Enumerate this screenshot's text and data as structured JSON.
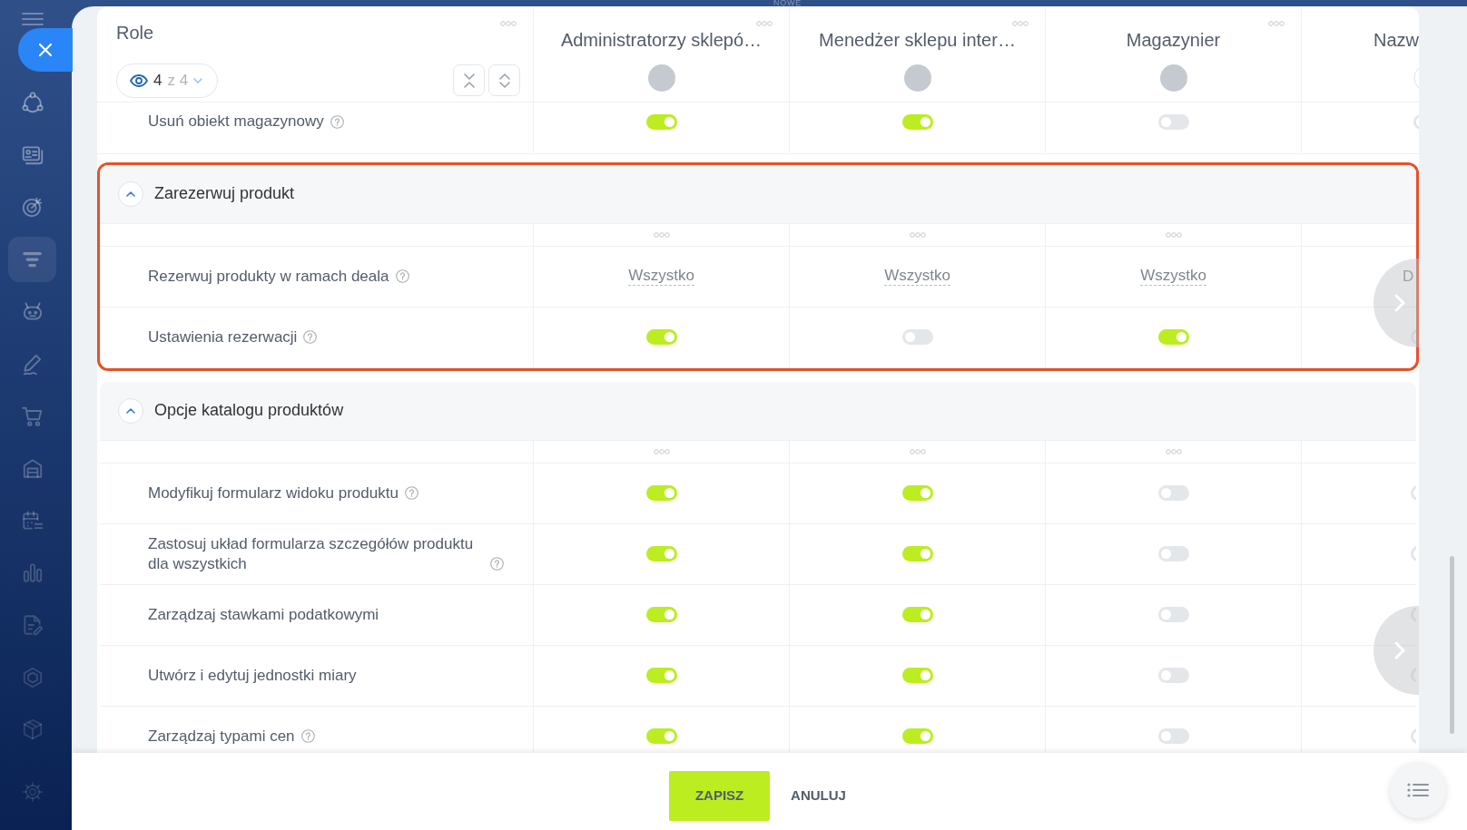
{
  "top_bar": {
    "label": "NOWE"
  },
  "sidebar": {
    "items": [
      {
        "selected": false
      },
      {
        "selected": false
      },
      {
        "selected": false
      },
      {
        "selected": true
      },
      {
        "selected": false
      },
      {
        "selected": false
      },
      {
        "selected": false
      },
      {
        "selected": false
      },
      {
        "selected": false
      },
      {
        "selected": false
      },
      {
        "selected": false
      },
      {
        "selected": false
      },
      {
        "selected": false
      },
      {
        "selected": false
      }
    ]
  },
  "roles_header": {
    "title": "Role",
    "filter": {
      "shown": "4",
      "of": "z 4"
    },
    "roles": [
      {
        "name": "Administratorzy sklepó…"
      },
      {
        "name": "Menedżer sklepu inter…"
      },
      {
        "name": "Magazynier"
      }
    ],
    "partial_role": {
      "name": "Nazw"
    }
  },
  "rows_above": [
    {
      "label": "Usuń obiekt magazynowy",
      "help": true,
      "cells": [
        {
          "kind": "toggle",
          "on": true
        },
        {
          "kind": "toggle",
          "on": true
        },
        {
          "kind": "toggle",
          "on": false
        }
      ],
      "partial_cell": {
        "kind": "toggle",
        "on": false
      }
    }
  ],
  "sections": [
    {
      "title": "Zarezerwuj produkt",
      "expanded": true,
      "highlighted": true,
      "rows": [
        {
          "label": "Rezerwuj produkty w ramach deala",
          "help": true,
          "cells": [
            {
              "kind": "select",
              "value": "Wszystko"
            },
            {
              "kind": "select",
              "value": "Wszystko"
            },
            {
              "kind": "select",
              "value": "Wszystko"
            }
          ],
          "partial_cell": {
            "kind": "select",
            "value": "D"
          }
        },
        {
          "label": "Ustawienia rezerwacji",
          "help": true,
          "cells": [
            {
              "kind": "toggle",
              "on": true
            },
            {
              "kind": "toggle",
              "on": false
            },
            {
              "kind": "toggle",
              "on": true
            }
          ],
          "partial_cell": {
            "kind": "toggle",
            "on": false
          }
        }
      ]
    },
    {
      "title": "Opcje katalogu produktów",
      "expanded": true,
      "rows": [
        {
          "label": "Modyfikuj formularz widoku produktu",
          "help": true,
          "cells": [
            {
              "kind": "toggle",
              "on": true
            },
            {
              "kind": "toggle",
              "on": true
            },
            {
              "kind": "toggle",
              "on": false
            }
          ],
          "partial_cell": {
            "kind": "toggle",
            "on": false
          }
        },
        {
          "label": "Zastosuj układ formularza szczegółów produktu dla wszystkich",
          "help": true,
          "cells": [
            {
              "kind": "toggle",
              "on": true
            },
            {
              "kind": "toggle",
              "on": true
            },
            {
              "kind": "toggle",
              "on": false
            }
          ],
          "partial_cell": {
            "kind": "toggle",
            "on": false
          }
        },
        {
          "label": "Zarządzaj stawkami podatkowymi",
          "help": false,
          "cells": [
            {
              "kind": "toggle",
              "on": true
            },
            {
              "kind": "toggle",
              "on": true
            },
            {
              "kind": "toggle",
              "on": false
            }
          ],
          "partial_cell": {
            "kind": "toggle",
            "on": false
          }
        },
        {
          "label": "Utwórz i edytuj jednostki miary",
          "help": false,
          "cells": [
            {
              "kind": "toggle",
              "on": true
            },
            {
              "kind": "toggle",
              "on": true
            },
            {
              "kind": "toggle",
              "on": false
            }
          ],
          "partial_cell": {
            "kind": "toggle",
            "on": false
          }
        },
        {
          "label": "Zarządzaj typami cen",
          "help": true,
          "cells": [
            {
              "kind": "toggle",
              "on": true
            },
            {
              "kind": "toggle",
              "on": true
            },
            {
              "kind": "toggle",
              "on": false
            }
          ],
          "partial_cell": {
            "kind": "toggle",
            "on": false
          }
        }
      ]
    }
  ],
  "footer": {
    "save": "ZAPISZ",
    "cancel": "ANULUJ"
  }
}
